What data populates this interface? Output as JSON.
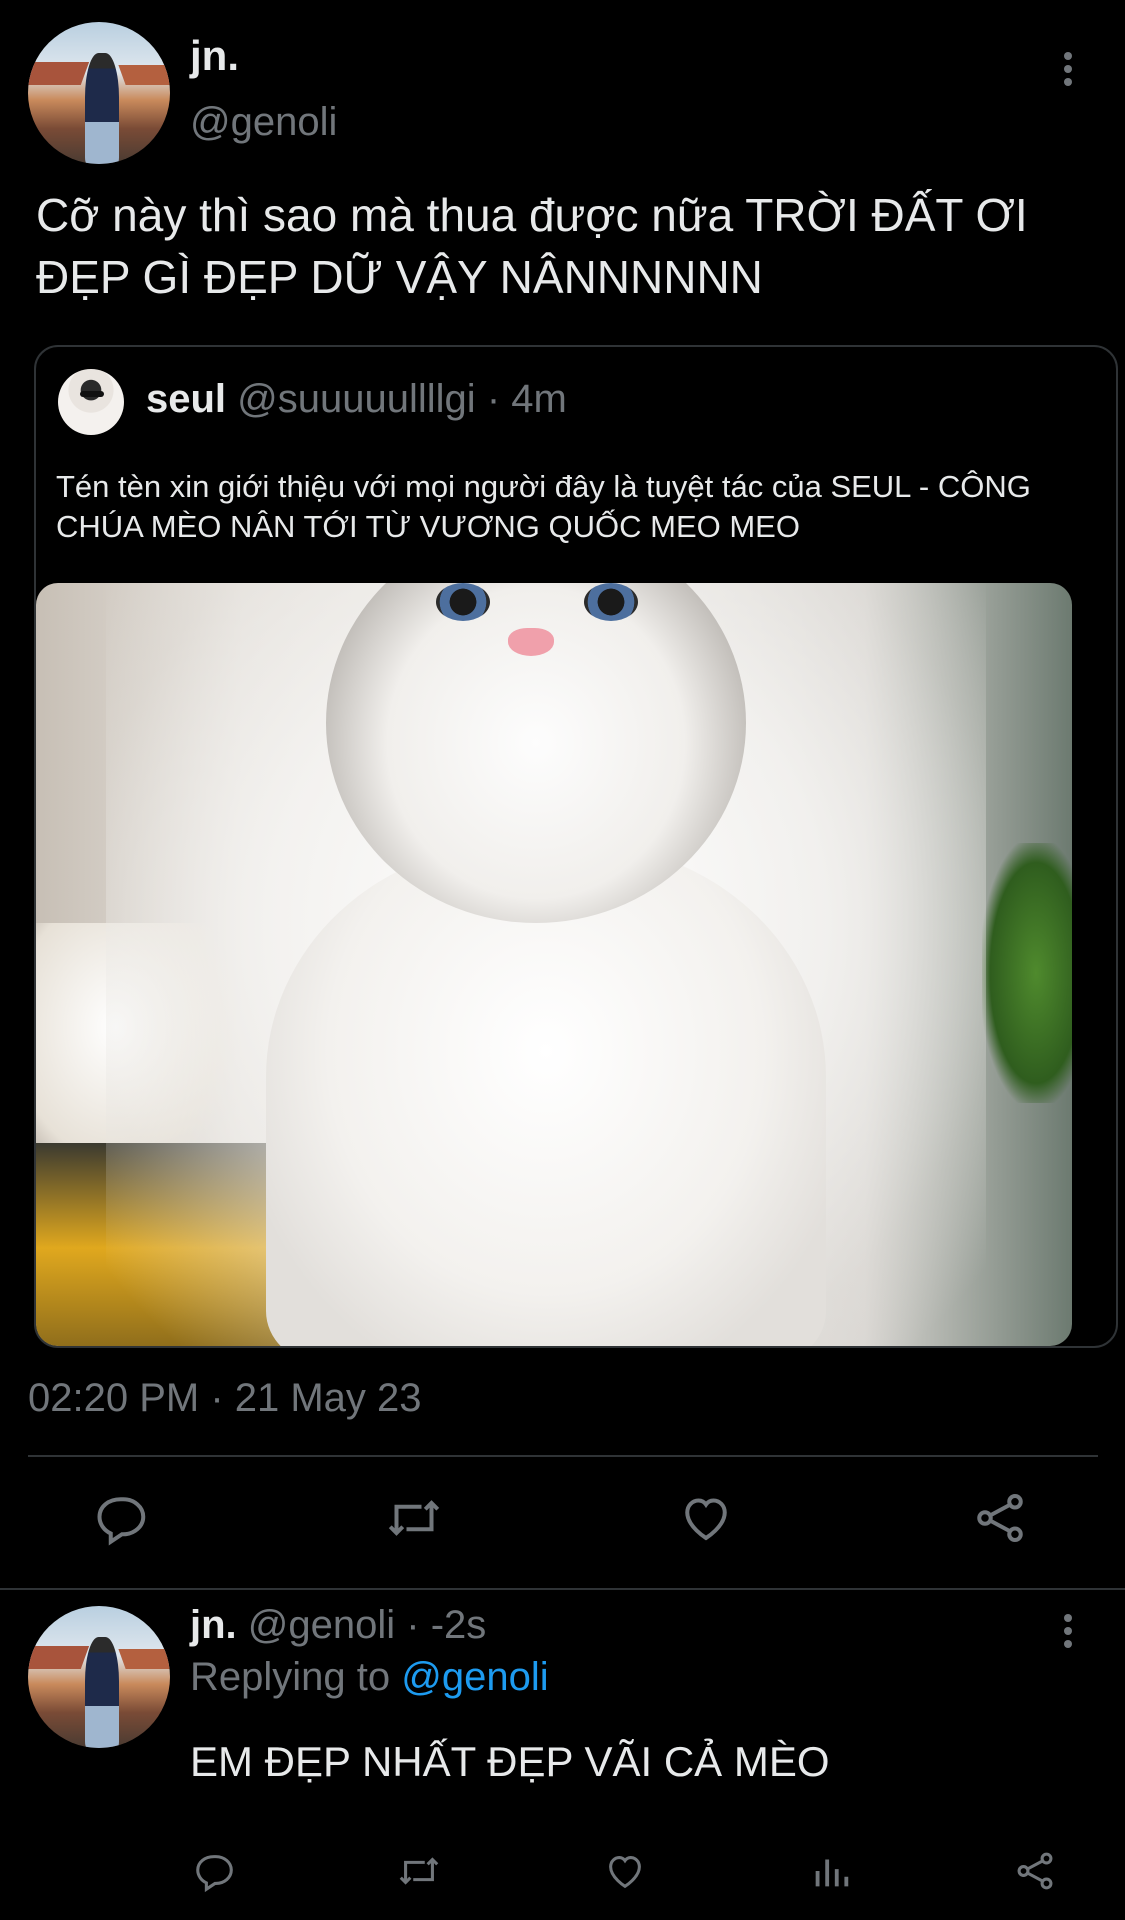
{
  "tweet": {
    "name": "jn.",
    "handle": "@genoli",
    "text": "Cỡ này thì sao mà thua được nữa TRỜI ĐẤT ƠI ĐẸP GÌ ĐẸP DỮ VẬY NÂNNNNNN",
    "timestamp": "02:20 PM · 21 May 23"
  },
  "quote": {
    "name": "seul",
    "handle": "@suuuuullllgi",
    "time": "· 4m",
    "text": "Tén tèn xin giới thiệu với mọi người đây là tuyệt tác của SEUL - CÔNG CHÚA MÈO NÂN TỚI TỪ VƯƠNG QUỐC MEO MEO"
  },
  "reply": {
    "name": "jn.",
    "handle": "@genoli",
    "time": "· -2s",
    "replying_prefix": "Replying to",
    "replying_handle": "@genoli",
    "text": "EM ĐẸP NHẤT ĐẸP VÃI CẢ MÈO"
  },
  "icons": {
    "actions": [
      "reply-icon",
      "retweet-icon",
      "like-icon",
      "share-icon"
    ],
    "reply_actions": [
      "reply-icon",
      "retweet-icon",
      "like-icon",
      "analytics-icon",
      "share-icon"
    ],
    "more": "more-vertical-icon"
  },
  "colors": {
    "background": "#000000",
    "text": "#e7e9ea",
    "muted": "#71767b",
    "link": "#1d9bf0",
    "border": "#2f3336"
  }
}
